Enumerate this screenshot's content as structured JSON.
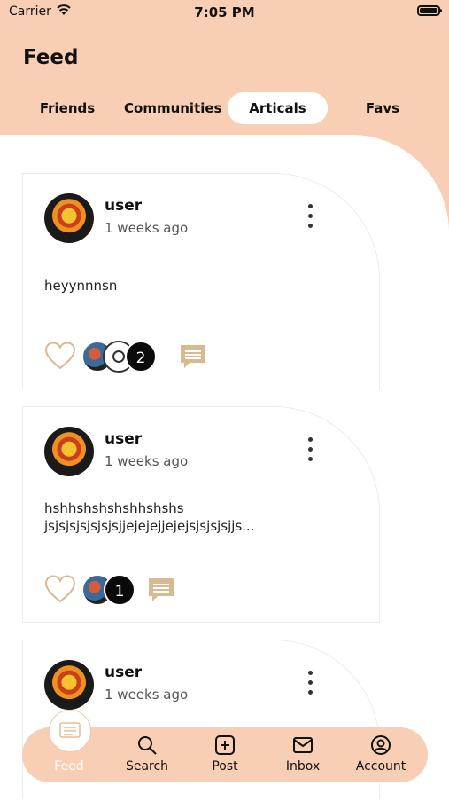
{
  "status_bar": {
    "carrier": "Carrier",
    "time": "7:05 PM"
  },
  "header": {
    "title": "Feed"
  },
  "tabs": [
    {
      "label": "Friends",
      "active": false
    },
    {
      "label": "Communities",
      "active": false
    },
    {
      "label": "Articals",
      "active": true
    },
    {
      "label": "Favs",
      "active": false
    }
  ],
  "posts": [
    {
      "user": "user",
      "time": "1 weeks ago",
      "text": "heyynnnsn",
      "like_count": "2"
    },
    {
      "user": "user",
      "time": "1 weeks ago",
      "text": "hshhshshshshhshshs jsjsjsjsjsjsjsjjejejejjejejsjsjsjsjjs...",
      "like_count": "1"
    },
    {
      "user": "user",
      "time": "1 weeks ago",
      "text": "",
      "like_count": ""
    }
  ],
  "bottom_nav": [
    {
      "label": "Feed",
      "icon": "feed-icon",
      "active": true
    },
    {
      "label": "Search",
      "icon": "search-icon",
      "active": false
    },
    {
      "label": "Post",
      "icon": "post-icon",
      "active": false
    },
    {
      "label": "Inbox",
      "icon": "inbox-icon",
      "active": false
    },
    {
      "label": "Account",
      "icon": "account-icon",
      "active": false
    }
  ],
  "colors": {
    "accent": "#f8cfb4",
    "comment_icon": "#d9b98f",
    "heart_outline": "#d9b98f"
  }
}
